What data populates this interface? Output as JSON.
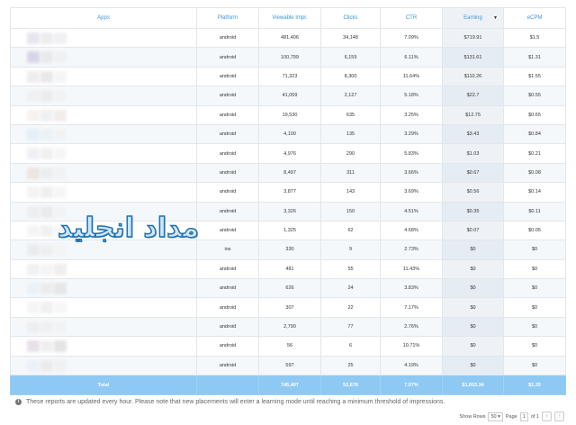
{
  "columns": {
    "apps": "Apps",
    "platform": "Platform",
    "impressions": "Viewable Impr.",
    "clicks": "Clicks",
    "ctr": "CTR",
    "earning": "Earning",
    "ecpm": "eCPM"
  },
  "rows": [
    {
      "platform": "android",
      "impressions": "481,406",
      "clicks": "34,148",
      "ctr": "7.09%",
      "earning": "$719.91",
      "ecpm": "$1.5"
    },
    {
      "platform": "android",
      "impressions": "100,799",
      "clicks": "6,159",
      "ctr": "6.11%",
      "earning": "$131.61",
      "ecpm": "$1.31"
    },
    {
      "platform": "android",
      "impressions": "71,323",
      "clicks": "8,300",
      "ctr": "11.64%",
      "earning": "$110.26",
      "ecpm": "$1.55"
    },
    {
      "platform": "android",
      "impressions": "41,059",
      "clicks": "2,127",
      "ctr": "5.18%",
      "earning": "$22.7",
      "ecpm": "$0.55"
    },
    {
      "platform": "android",
      "impressions": "19,530",
      "clicks": "635",
      "ctr": "3.25%",
      "earning": "$12.75",
      "ecpm": "$0.65"
    },
    {
      "platform": "android",
      "impressions": "4,100",
      "clicks": "135",
      "ctr": "3.29%",
      "earning": "$3.43",
      "ecpm": "$0.84"
    },
    {
      "platform": "android",
      "impressions": "4,976",
      "clicks": "290",
      "ctr": "5.83%",
      "earning": "$1.03",
      "ecpm": "$0.21"
    },
    {
      "platform": "android",
      "impressions": "8,497",
      "clicks": "311",
      "ctr": "3.66%",
      "earning": "$0.67",
      "ecpm": "$0.08"
    },
    {
      "platform": "android",
      "impressions": "3,877",
      "clicks": "143",
      "ctr": "3.69%",
      "earning": "$0.56",
      "ecpm": "$0.14"
    },
    {
      "platform": "android",
      "impressions": "3,326",
      "clicks": "150",
      "ctr": "4.51%",
      "earning": "$0.35",
      "ecpm": "$0.11"
    },
    {
      "platform": "android",
      "impressions": "1,325",
      "clicks": "62",
      "ctr": "4.68%",
      "earning": "$0.07",
      "ecpm": "$0.05"
    },
    {
      "platform": "ios",
      "impressions": "330",
      "clicks": "9",
      "ctr": "2.73%",
      "earning": "$0",
      "ecpm": "$0"
    },
    {
      "platform": "android",
      "impressions": "481",
      "clicks": "55",
      "ctr": "11.43%",
      "earning": "$0",
      "ecpm": "$0"
    },
    {
      "platform": "android",
      "impressions": "626",
      "clicks": "24",
      "ctr": "3.83%",
      "earning": "$0",
      "ecpm": "$0"
    },
    {
      "platform": "android",
      "impressions": "307",
      "clicks": "22",
      "ctr": "7.17%",
      "earning": "$0",
      "ecpm": "$0"
    },
    {
      "platform": "android",
      "impressions": "2,790",
      "clicks": "77",
      "ctr": "2.76%",
      "earning": "$0",
      "ecpm": "$0"
    },
    {
      "platform": "android",
      "impressions": "56",
      "clicks": "6",
      "ctr": "10.71%",
      "earning": "$0",
      "ecpm": "$0"
    },
    {
      "platform": "android",
      "impressions": "597",
      "clicks": "25",
      "ctr": "4.19%",
      "earning": "$0",
      "ecpm": "$0"
    }
  ],
  "total": {
    "label": "Total",
    "impressions": "745,407",
    "clicks": "52,678",
    "ctr": "7.07%",
    "earning": "$1,003.34",
    "ecpm": "$1.35"
  },
  "notice": "These reports are updated every hour. Please note that new placements will enter a learning mode until reaching a minimum threshold of impressions.",
  "pager": {
    "show_rows_label": "Show Rows",
    "rows_value": "50",
    "page_label": "Page",
    "page_value": "1",
    "of_label": "of 1"
  },
  "watermark": "مداد انجليد",
  "colors": {
    "header_text": "#3b94d9",
    "total_row_bg": "#8ec9f3",
    "sorted_column_bg": "#eef2f7"
  },
  "icons": {
    "sort": "sort-down-caret-icon",
    "info": "info-circle-icon",
    "prev": "chevron-left-icon",
    "next": "chevron-right-icon"
  }
}
